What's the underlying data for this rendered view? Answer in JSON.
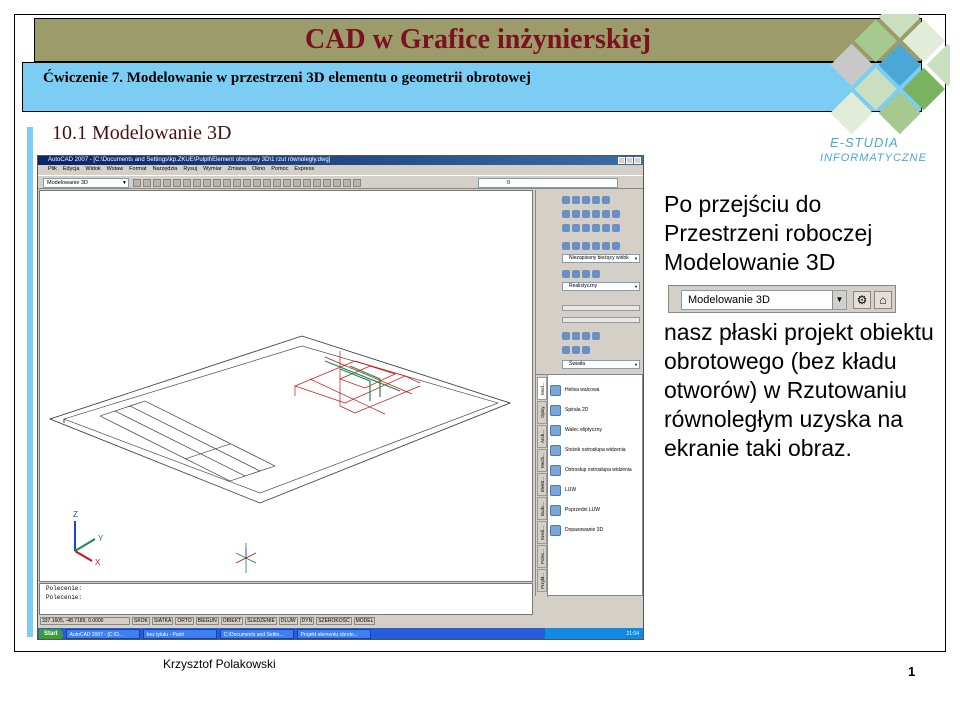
{
  "slide": {
    "title": "CAD w Grafice inżynierskiej",
    "subtitle": "Ćwiczenie 7. Modelowanie w przestrzeni 3D elementu o geometrii obrotowej",
    "section": "10.1 Modelowanie 3D",
    "logo_line1": "E-STUDIA",
    "logo_line2": "INFORMATYCZNE",
    "author": "Krzysztof Polakowski",
    "page_number": "1"
  },
  "description": {
    "part1": "Po przejściu do Przestrzeni roboczej Modelowanie 3D",
    "workspace_value": "Modelowanie 3D",
    "part2": "nasz płaski projekt obiektu obrotowego (bez kładu otworów) w Rzutowaniu równoległym uzyska na ekranie taki obraz."
  },
  "acad": {
    "window_title": "AutoCAD 2007 - [C:\\Documents and Settings\\kp.ZKUE\\Pulpit\\Element obrotowy 3D\\1 rzut równoległy.dwg]",
    "menu": [
      "Plik",
      "Edycja",
      "Widok",
      "Wstaw",
      "Format",
      "Narzędzia",
      "Rysuj",
      "Wymiar",
      "Zmiana",
      "Okno",
      "Pomoc",
      "Express"
    ],
    "workspace": "Modelowanie 3D",
    "layer": "0",
    "dashboard": {
      "view_select": "Niezapisany bieżący widok",
      "visual_style": "Realistyczny",
      "light_select": "Światła"
    },
    "palette_tabs": [
      "Mod...",
      "Opisy",
      "Arch...",
      "Mech...",
      "Elektr...",
      "Budo...",
      "Kreśl...",
      "Polec...",
      "Przykł..."
    ],
    "tools": [
      "Helisa walcowa",
      "Spirala 2D",
      "Walec eliptyczny",
      "Stożek ostrosłupa widzenia",
      "Ostrosłup ostrosłupa widzenia",
      "LUW",
      "Poprzedni LUW",
      "Dopasowanie 3D"
    ],
    "command_lines": [
      "Polecenie:",
      "Polecenie:"
    ],
    "coords": "337.1605, -48.7189, 0.0000",
    "status_buttons": [
      "SKOK",
      "SIATKA",
      "ORTO",
      "BIEGUN",
      "OBIEKT",
      "ŚLEDZENIE",
      "DLUW",
      "DYN",
      "SZEROKOŚĆ",
      "MODEL"
    ],
    "taskbar": {
      "start": "Start",
      "items": [
        "AutoCAD 2007 - [C:\\D...",
        "bez tytułu - Paint",
        "C:\\Documents and Settin...",
        "Projekt elementu obroto..."
      ],
      "clock": "21:04"
    },
    "ucs_labels": {
      "z": "Z",
      "y": "Y",
      "x": "X"
    }
  },
  "colors": {
    "title_bar": "#9c9c6a",
    "title_text": "#7a1020",
    "subtitle_bar": "#7ccdf3",
    "accent": "#4aa7d6"
  }
}
